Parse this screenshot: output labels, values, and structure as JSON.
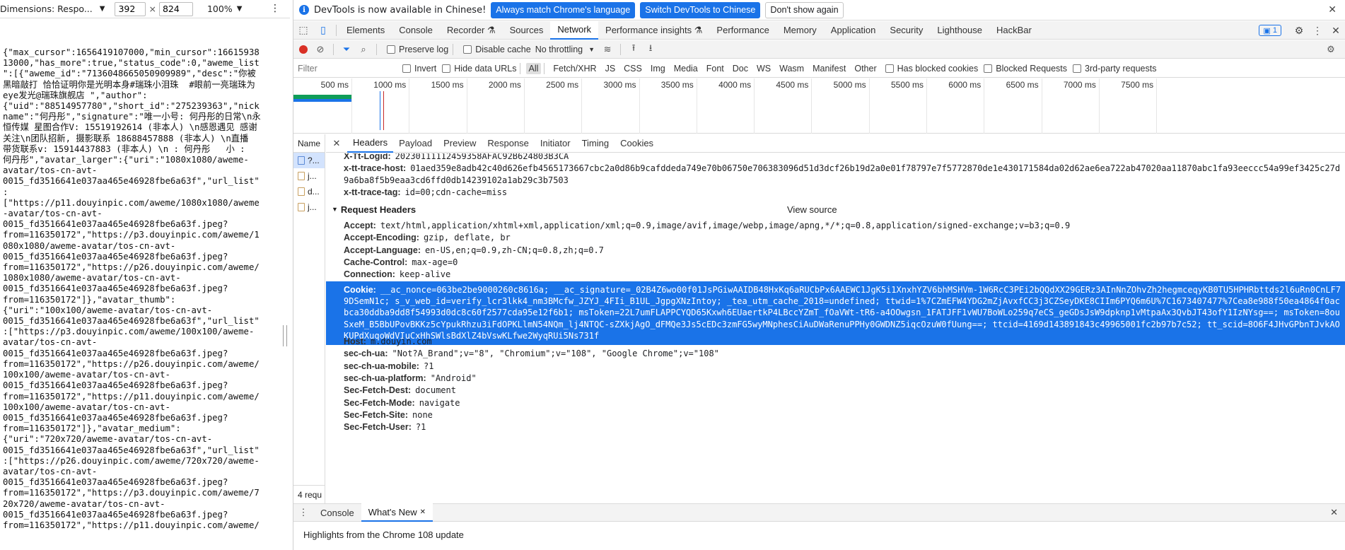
{
  "device_toolbar": {
    "dimensions_label": "Dimensions: Respo...",
    "width_value": "392",
    "height_value": "824",
    "times": "×",
    "zoom": "100%"
  },
  "page_json_lines": [
    "{\"max_cursor\":1656419107000,\"min_cursor\":16615938",
    "13000,\"has_more\":true,\"status_code\":0,\"aweme_list",
    "\":[{\"aweme_id\":\"7136048665050909989\",\"desc\":\"你被",
    "黑暗敲打 恰恰证明你是光明本身#瑞珠小泪珠  #眼前一亮瑞珠为",
    "eye发光@瑞珠旗舰店 \",\"author\":",
    "{\"uid\":\"88514957780\",\"short_id\":\"275239363\",\"nick",
    "name\":\"何丹彤\",\"signature\":\"唯一小号: 何丹彤的日常\\n永",
    "恒传媒 星图合作V: 15519192614 (非本人) \\n感恩遇见 感谢",
    "关注\\n团队招新, 摄影联系 18688457888 (非本人) \\n直播",
    "带货联系v: 15914437883 (非本人) \\n : 何丹彤   小 :",
    "何丹彤\",\"avatar_larger\":{\"uri\":\"1080x1080/aweme-",
    "avatar/tos-cn-avt-",
    "0015_fd3516641e037aa465e46928fbe6a63f\",\"url_list\"",
    ":",
    "[\"https://p11.douyinpic.com/aweme/1080x1080/aweme",
    "-avatar/tos-cn-avt-",
    "0015_fd3516641e037aa465e46928fbe6a63f.jpeg?",
    "from=116350172\",\"https://p3.douyinpic.com/aweme/1",
    "080x1080/aweme-avatar/tos-cn-avt-",
    "0015_fd3516641e037aa465e46928fbe6a63f.jpeg?",
    "from=116350172\",\"https://p26.douyinpic.com/aweme/",
    "1080x1080/aweme-avatar/tos-cn-avt-",
    "0015_fd3516641e037aa465e46928fbe6a63f.jpeg?",
    "from=116350172\"]},\"avatar_thumb\":",
    "{\"uri\":\"100x100/aweme-avatar/tos-cn-avt-",
    "0015_fd3516641e037aa465e46928fbe6a63f\",\"url_list\"",
    ":[\"https://p3.douyinpic.com/aweme/100x100/aweme-",
    "avatar/tos-cn-avt-",
    "0015_fd3516641e037aa465e46928fbe6a63f.jpeg?",
    "from=116350172\",\"https://p26.douyinpic.com/aweme/",
    "100x100/aweme-avatar/tos-cn-avt-",
    "0015_fd3516641e037aa465e46928fbe6a63f.jpeg?",
    "from=116350172\",\"https://p11.douyinpic.com/aweme/",
    "100x100/aweme-avatar/tos-cn-avt-",
    "0015_fd3516641e037aa465e46928fbe6a63f.jpeg?",
    "from=116350172\"]},\"avatar_medium\":",
    "{\"uri\":\"720x720/aweme-avatar/tos-cn-avt-",
    "0015_fd3516641e037aa465e46928fbe6a63f\",\"url_list\"",
    ":[\"https://p26.douyinpic.com/aweme/720x720/aweme-",
    "avatar/tos-cn-avt-",
    "0015_fd3516641e037aa465e46928fbe6a63f.jpeg?",
    "from=116350172\",\"https://p3.douyinpic.com/aweme/7",
    "20x720/aweme-avatar/tos-cn-avt-",
    "0015_fd3516641e037aa465e46928fbe6a63f.jpeg?",
    "from=116350172\",\"https://p11.douyinpic.com/aweme/"
  ],
  "info_bar": {
    "message": "DevTools is now available in Chinese!",
    "match_button": "Always match Chrome's language",
    "switch_button": "Switch DevTools to Chinese",
    "dismiss_button": "Don't show again"
  },
  "tabs": [
    "Elements",
    "Console",
    "Recorder ⚗",
    "Sources",
    "Network",
    "Performance insights ⚗",
    "Performance",
    "Memory",
    "Application",
    "Security",
    "Lighthouse",
    "HackBar"
  ],
  "active_tab": "Network",
  "issues_count": "1",
  "network_toolbar": {
    "preserve_log": "Preserve log",
    "disable_cache": "Disable cache",
    "throttling": "No throttling"
  },
  "filter_bar": {
    "placeholder": "Filter",
    "invert": "Invert",
    "hide_data_urls": "Hide data URLs",
    "types": [
      "All",
      "Fetch/XHR",
      "JS",
      "CSS",
      "Img",
      "Media",
      "Font",
      "Doc",
      "WS",
      "Wasm",
      "Manifest",
      "Other"
    ],
    "active_type": "All",
    "has_blocked_cookies": "Has blocked cookies",
    "blocked_requests": "Blocked Requests",
    "third_party": "3rd-party requests"
  },
  "timeline_ticks": [
    "500 ms",
    "1000 ms",
    "1500 ms",
    "2000 ms",
    "2500 ms",
    "3000 ms",
    "3500 ms",
    "4000 ms",
    "4500 ms",
    "5000 ms",
    "5500 ms",
    "6000 ms",
    "6500 ms",
    "7000 ms",
    "7500 ms"
  ],
  "requests": {
    "header": "Name",
    "rows": [
      "?...",
      "j...",
      "d...",
      "j..."
    ],
    "footer": "4 requ"
  },
  "detail_tabs": [
    "Headers",
    "Payload",
    "Preview",
    "Response",
    "Initiator",
    "Timing",
    "Cookies"
  ],
  "active_detail_tab": "Headers",
  "response_headers_partial": [
    {
      "name": "X-Tt-Logid:",
      "value": "20230111112459358AFAC92B624803B3CA"
    },
    {
      "name": "x-tt-trace-host:",
      "value": "01aed359e8adb42c40d626efb4565173667cbc2a0d86b9cafddeda749e70b06750e706383096d51d3dcf26b19d2a0e01f78797e7f5772870de1e430171584da02d62ae6ea722ab47020aa11870abc1fa93eeccc54a99ef3425c27d"
    },
    {
      "name": "",
      "value": "9a6ba8f5b9eaa3cd6ffd0db14239102a1ab29c3b7503"
    },
    {
      "name": "x-tt-trace-tag:",
      "value": "id=00;cdn-cache=miss"
    }
  ],
  "request_headers_title": "Request Headers",
  "view_source": "View source",
  "request_headers_top": [
    {
      "name": "Accept:",
      "value": "text/html,application/xhtml+xml,application/xml;q=0.9,image/avif,image/webp,image/apng,*/*;q=0.8,application/signed-exchange;v=b3;q=0.9"
    },
    {
      "name": "Accept-Encoding:",
      "value": "gzip, deflate, br"
    },
    {
      "name": "Accept-Language:",
      "value": "en-US,en;q=0.9,zh-CN;q=0.8,zh;q=0.7"
    },
    {
      "name": "Cache-Control:",
      "value": "max-age=0"
    },
    {
      "name": "Connection:",
      "value": "keep-alive"
    }
  ],
  "cookie": {
    "name": "Cookie:",
    "value": "__ac_nonce=063be2be9000260c8616a; __ac_signature=_02B4Z6wo00f01JsPGiwAAIDB48HxKq6aRUCbPx6AAEWC1JgK5i1XnxhYZV6bhMSHVm-1W6RcC3PEi2bQQdXX29GERz3AInNnZOhvZh2hegmceqyKB0TU5HPHRbttds2l6uRn0CnLF79DSemN1c; s_v_web_id=verify_lcr3lkk4_nm3BMcfw_JZYJ_4FIi_B1UL_JgpgXNzIntoy; _tea_utm_cache_2018=undefined; ttwid=1%7CZmEFW4YDG2mZjAvxfCC3j3CZSeyDKE8CIIm6PYQ6m6U%7C1673407477%7Cea8e988f50ea4864f0acbca30ddba9dd8f54993d0dc8c60f2577cda95e12f6b1; msToken=22L7umFLAPPCYQD65Kxwh6EUaertkP4LBccYZmT_fOaVWt-tR6-a4OOwgsn_1FATJFF1vWU7BoWLo259q7eCS_geGDsJsW9dpknp1vMtpaAx3QvbJT43ofY1IzNYsg==; msToken=8ouSxeM_B5BbUPovBKKz5cYpukRhzu3iFdOPKLlmN54NQm_lj4NTQC-sZXkjAgO_dFMQe3Js5cEDc3zmFG5wyMNphesCiAuDWaRenuPPHy0GWDNZ5iqcOzuW0fUung==; ttcid=4169d143891843c49965001fc2b97b7c52; tt_scid=8O6F4JHvGPbnTJvkAOKUPdXuqoWdVIuCxHhSWlsBdXlZ4bVswKLfwe2WyqRUi5Ns731f"
  },
  "request_headers_bottom": [
    {
      "name": "Host:",
      "value": "m.douyin.com"
    },
    {
      "name": "sec-ch-ua:",
      "value": "\"Not?A_Brand\";v=\"8\", \"Chromium\";v=\"108\", \"Google Chrome\";v=\"108\""
    },
    {
      "name": "sec-ch-ua-mobile:",
      "value": "?1"
    },
    {
      "name": "sec-ch-ua-platform:",
      "value": "\"Android\""
    },
    {
      "name": "Sec-Fetch-Dest:",
      "value": "document"
    },
    {
      "name": "Sec-Fetch-Mode:",
      "value": "navigate"
    },
    {
      "name": "Sec-Fetch-Site:",
      "value": "none"
    },
    {
      "name": "Sec-Fetch-User:",
      "value": "?1"
    }
  ],
  "drawer": {
    "tabs": [
      "Console",
      "What's New"
    ],
    "active": "What's New",
    "body": "Highlights from the Chrome 108 update"
  },
  "colors": {
    "accent": "#1a73e8",
    "record": "#d93025",
    "selection": "#1a73e8"
  }
}
